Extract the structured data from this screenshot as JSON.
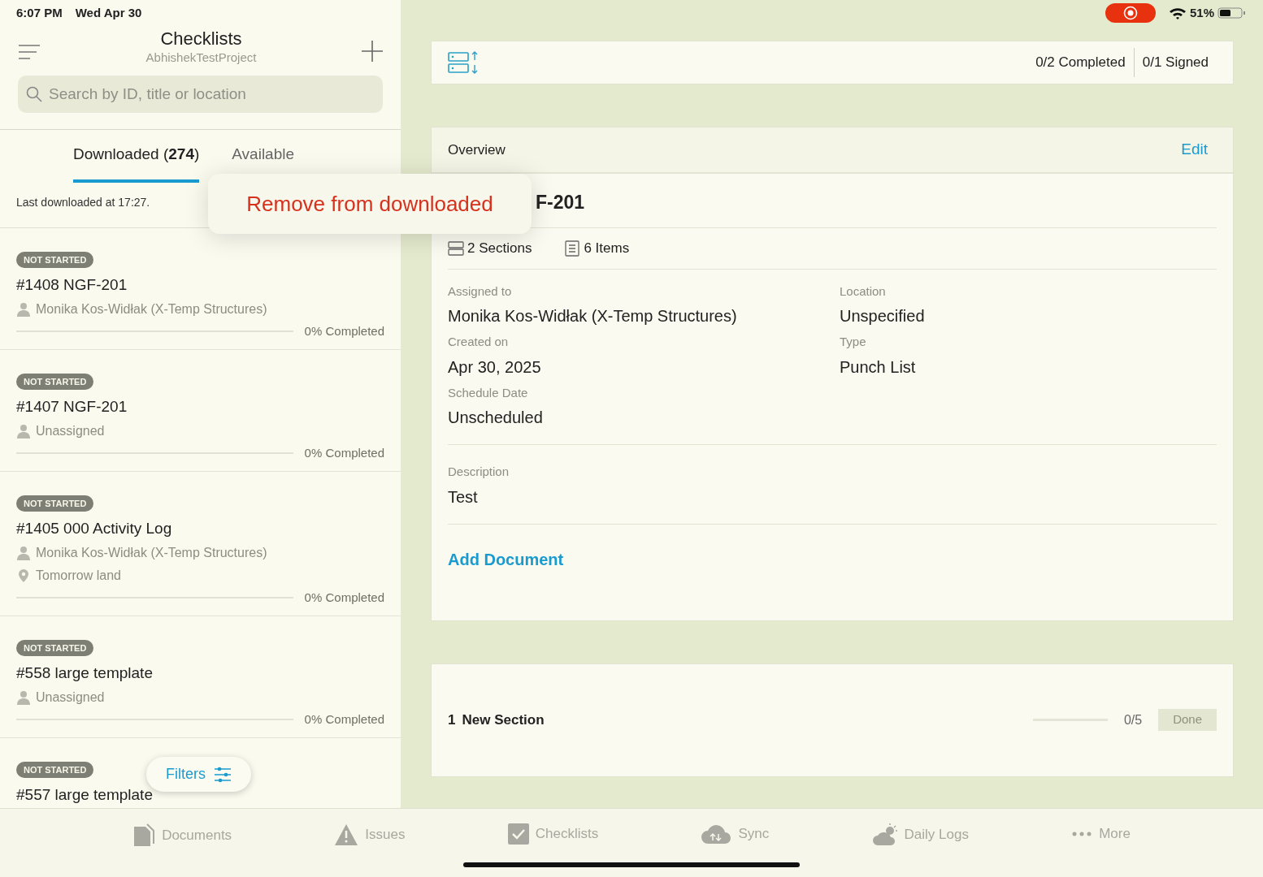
{
  "status_bar": {
    "time": "6:07 PM",
    "date": "Wed Apr 30",
    "recording": true,
    "battery": "51%"
  },
  "sidebar": {
    "title": "Checklists",
    "subtitle": "AbhishekTestProject",
    "search": {
      "placeholder": "Search by ID, title or location"
    },
    "tabs": [
      {
        "label": "Downloaded (**274**)",
        "selected": true
      },
      {
        "label": "Available",
        "selected": false
      }
    ],
    "last_downloaded": "Last downloaded at 17:27.",
    "items": [
      {
        "status": "NOT STARTED",
        "title": "#1408 NGF-201",
        "assignee": "Monika Kos-Widłak (X-Temp Structures)",
        "progress": "0% Completed",
        "level": 0
      },
      {
        "status": "NOT STARTED",
        "title": "#1407 NGF-201",
        "assignee": "Unassigned",
        "progress": "0% Completed",
        "level": 0
      },
      {
        "status": "NOT STARTED",
        "title": "#1405 000 Activity Log",
        "assignee": "Monika Kos-Widłak (X-Temp Structures)",
        "location": "Tomorrow land",
        "progress": "0% Completed",
        "level": 0
      },
      {
        "status": "NOT STARTED",
        "title": "#558 large template",
        "assignee": "Unassigned",
        "progress": "0% Completed",
        "level": 0
      },
      {
        "status": "NOT STARTED",
        "title": "#557 large template"
      }
    ],
    "filters_button": "Filters"
  },
  "context_menu": {
    "items": [
      "Remove from downloaded"
    ]
  },
  "toolbar": {
    "completed": "0/2 Completed",
    "signed": "0/1 Signed"
  },
  "overview": {
    "header": "Overview",
    "edit": "Edit",
    "title": "F-201",
    "sections": "2 Sections",
    "items": "6 Items",
    "fields": [
      {
        "label": "Assigned to",
        "value": "Monika Kos-Widłak (X-Temp Structures)"
      },
      {
        "label": "Location",
        "value": "Unspecified"
      },
      {
        "label": "Created on",
        "value": "Apr 30, 2025"
      },
      {
        "label": "Type",
        "value": "Punch List"
      },
      {
        "label": "Schedule Date",
        "value": "Unscheduled"
      }
    ],
    "description_label": "Description",
    "description": "Test",
    "add_document": "Add Document"
  },
  "sections": [
    {
      "number": "1",
      "title": "New Section",
      "count": "0/5",
      "level": 0,
      "done": "Done",
      "disabled": true
    }
  ],
  "tab_bar": [
    {
      "label": "Documents"
    },
    {
      "label": "Issues"
    },
    {
      "label": "Checklists"
    },
    {
      "label": "Sync"
    },
    {
      "label": "Daily Logs"
    },
    {
      "label": "More"
    }
  ]
}
